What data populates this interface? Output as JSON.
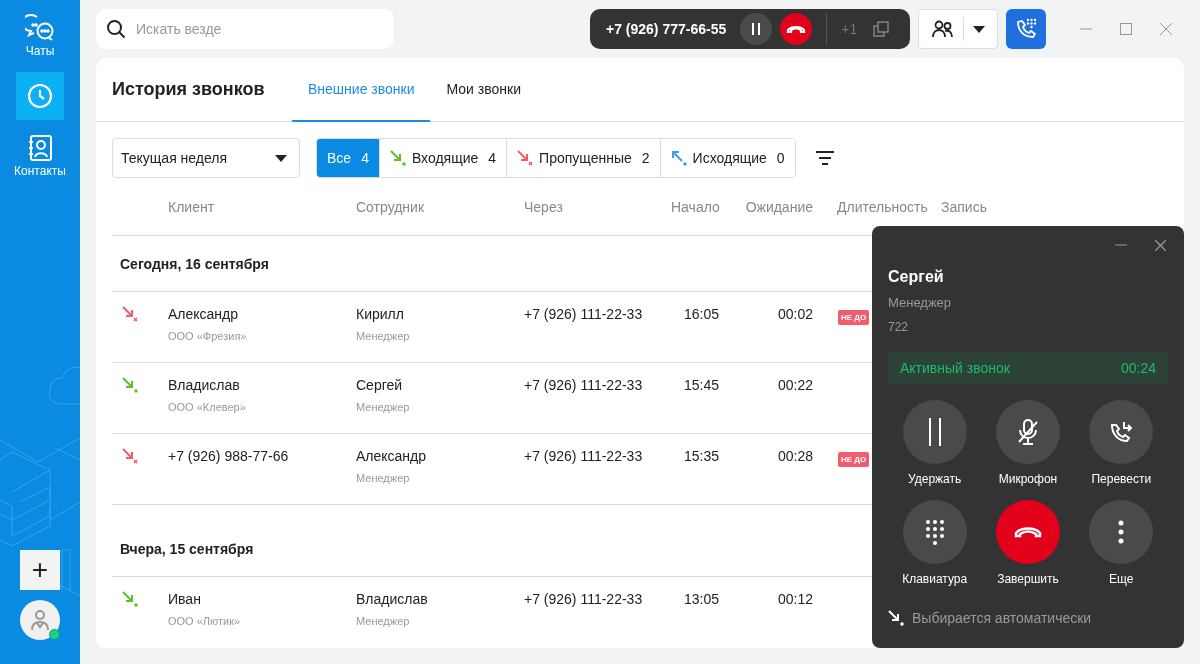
{
  "sidebar": {
    "items": [
      {
        "kind": "chats",
        "label": "Чаты",
        "selected": false
      },
      {
        "kind": "history",
        "selected": true
      },
      {
        "kind": "contacts",
        "label": "Контакты",
        "selected": false
      }
    ],
    "add_button": "+",
    "user": {
      "online": true
    }
  },
  "search": {
    "placeholder": "Искать везде"
  },
  "active_call": {
    "number": "+7 (926) 777-66-55",
    "extra": "+1"
  },
  "page": {
    "title": "История звонков",
    "tabs": [
      {
        "label": "Внешние звонки",
        "selected": true
      },
      {
        "label": "Мои звонки",
        "selected": false
      }
    ]
  },
  "period": {
    "value": "Текущая неделя"
  },
  "filters": [
    {
      "kind": "all",
      "label": "Все",
      "count": "4",
      "selected": true
    },
    {
      "kind": "incoming",
      "label": "Входящие",
      "count": "4",
      "selected": false
    },
    {
      "kind": "missed",
      "label": "Пропущенные",
      "count": "2",
      "selected": false
    },
    {
      "kind": "outgoing",
      "label": "Исходящие",
      "count": "0",
      "selected": false
    }
  ],
  "table": {
    "columns": [
      "Клиент",
      "Сотрудник",
      "Через",
      "Начало",
      "Ожидание",
      "Длительность",
      "Запись"
    ],
    "groups": [
      {
        "title": "Сегодня, 16 сентября",
        "rows": [
          {
            "kind": "missed",
            "client": "Александр",
            "company": "ООО «Фрезия»",
            "employee": "Кирилл",
            "role": "Менеджер",
            "via": "+7 (926) 111-22-33",
            "start": "16:05",
            "wait": "00:02",
            "badge": "НЕ ДО"
          },
          {
            "kind": "incoming",
            "client": "Владислав",
            "company": "ООО «Клевер»",
            "employee": "Сергей",
            "role": "Менеджер",
            "via": "+7 (926) 111-22-33",
            "start": "15:45",
            "wait": "00:22"
          },
          {
            "kind": "missed",
            "client": "+7 (926) 988-77-66",
            "employee": "Александр",
            "role": "Менеджер",
            "via": "+7 (926) 111-22-33",
            "start": "15:35",
            "wait": "00:28",
            "badge": "НЕ ДО"
          }
        ]
      },
      {
        "title": "Вчера, 15 сентября",
        "rows": [
          {
            "kind": "incoming",
            "client": "Иван",
            "company": "ООО «Лютик»",
            "employee": "Владислав",
            "role": "Менеджер",
            "via": "+7 (926) 111-22-33",
            "start": "13:05",
            "wait": "00:12"
          }
        ]
      }
    ]
  },
  "call_panel": {
    "name": "Сергей",
    "role": "Менеджер",
    "ext": "722",
    "status": "Активный звонок",
    "timer": "00:24",
    "actions": [
      {
        "kind": "hold",
        "label": "Удержать"
      },
      {
        "kind": "mic",
        "label": "Микрофон"
      },
      {
        "kind": "transfer",
        "label": "Перевести"
      },
      {
        "kind": "keypad",
        "label": "Клавиатура"
      },
      {
        "kind": "end",
        "label": "Завершить"
      },
      {
        "kind": "more",
        "label": "Еще"
      }
    ],
    "route": "Выбирается автоматически"
  }
}
